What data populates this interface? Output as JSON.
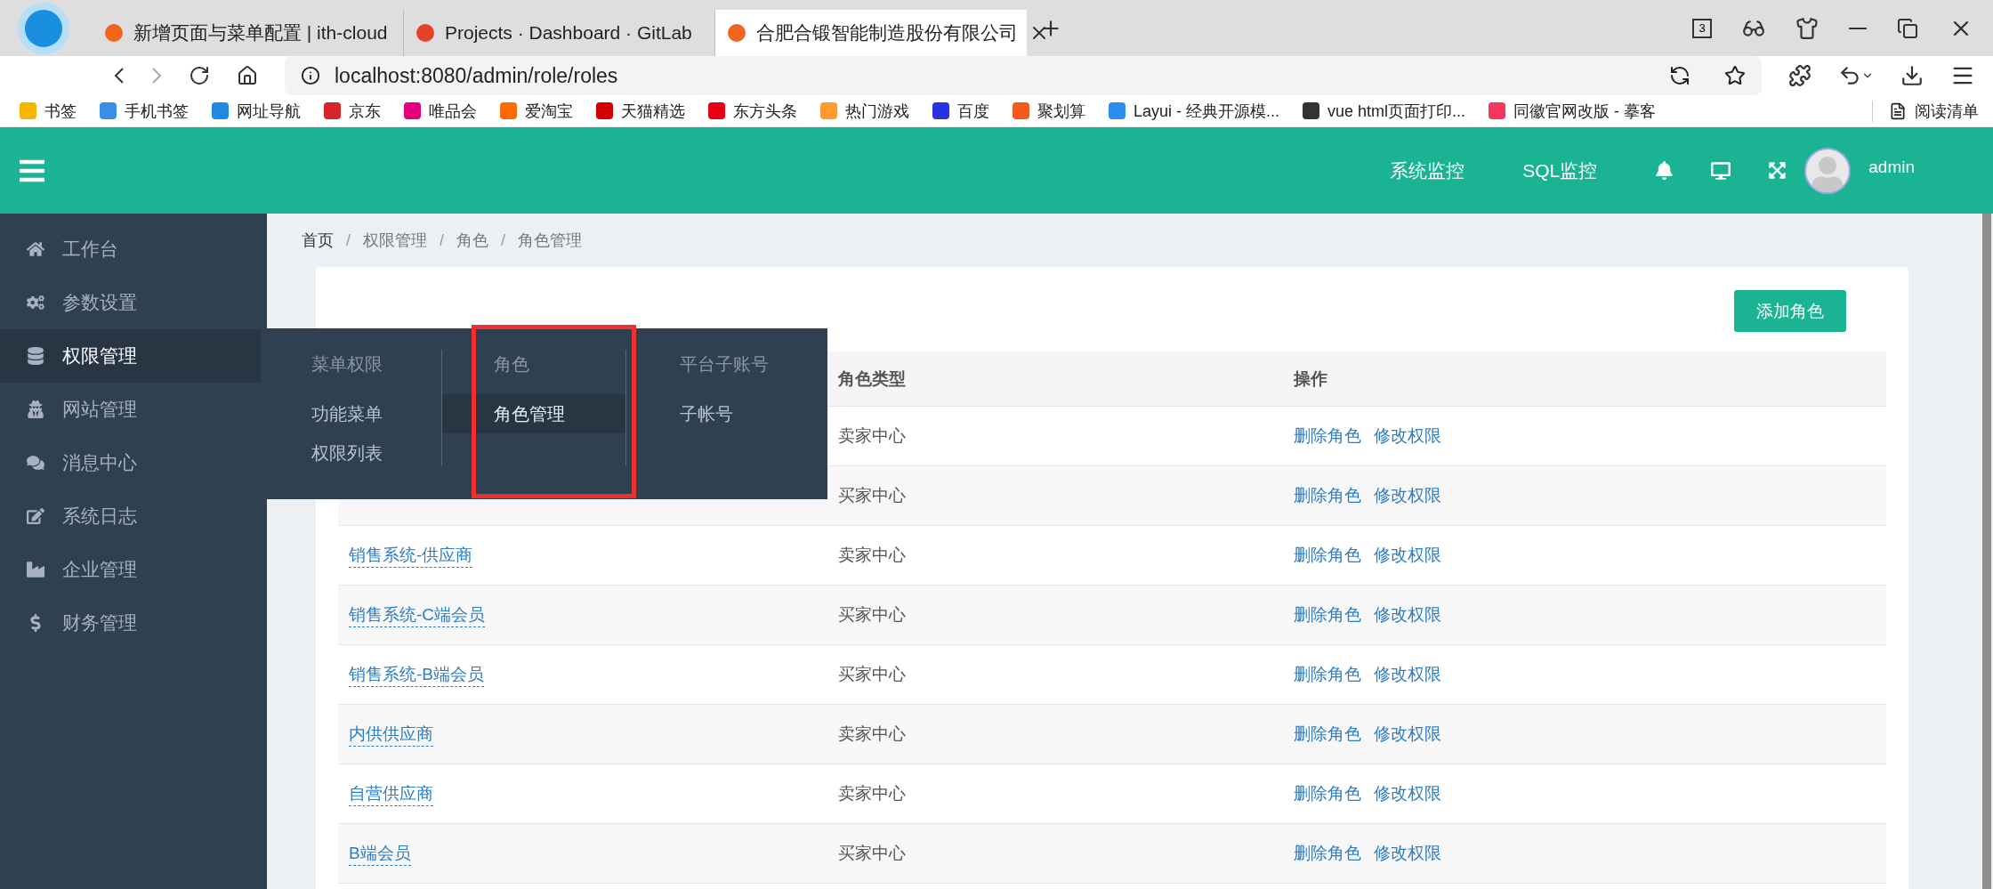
{
  "browser": {
    "tabs": [
      {
        "title": "新增页面与菜单配置 | ith-cloud",
        "selected": false
      },
      {
        "title": "Projects · Dashboard · GitLab",
        "selected": false
      },
      {
        "title": "合肥合锻智能制造股份有限公司",
        "selected": true
      }
    ],
    "tab_count": "3",
    "address": "localhost:8080/admin/role/roles",
    "bookmarks": [
      {
        "label": "书签",
        "color": "#f5b400"
      },
      {
        "label": "手机书签",
        "color": "#3a8ee6"
      },
      {
        "label": "网址导航",
        "color": "#1e88e5"
      },
      {
        "label": "京东",
        "color": "#d8232a"
      },
      {
        "label": "唯品会",
        "color": "#e4007f"
      },
      {
        "label": "爱淘宝",
        "color": "#ff6a00"
      },
      {
        "label": "天猫精选",
        "color": "#d40000"
      },
      {
        "label": "东方头条",
        "color": "#e60012"
      },
      {
        "label": "热门游戏",
        "color": "#ff9a2e"
      },
      {
        "label": "百度",
        "color": "#2932e1"
      },
      {
        "label": "聚划算",
        "color": "#f25a1f"
      },
      {
        "label": "Layui - 经典开源模...",
        "color": "#2d8cf0"
      },
      {
        "label": "vue html页面打印...",
        "color": "#333333"
      },
      {
        "label": "同徽官网改版 - 摹客",
        "color": "#f5365c"
      }
    ],
    "reading_list": "阅读清单"
  },
  "header": {
    "links": [
      "系统监控",
      "SQL监控"
    ],
    "user": "admin"
  },
  "sidebar": {
    "items": [
      {
        "label": "工作台",
        "selected": false
      },
      {
        "label": "参数设置",
        "selected": false
      },
      {
        "label": "权限管理",
        "selected": true
      },
      {
        "label": "网站管理",
        "selected": false
      },
      {
        "label": "消息中心",
        "selected": false
      },
      {
        "label": "系统日志",
        "selected": false
      },
      {
        "label": "企业管理",
        "selected": false
      },
      {
        "label": "财务管理",
        "selected": false
      }
    ]
  },
  "breadcrumb": {
    "items": [
      "首页",
      "权限管理",
      "角色",
      "角色管理"
    ],
    "separators": [
      "/",
      "/",
      "/"
    ]
  },
  "flyout": {
    "columns": [
      {
        "heading": "菜单权限",
        "outlined": false,
        "items": [
          {
            "label": "功能菜单",
            "selected": false
          },
          {
            "label": "权限列表",
            "selected": false
          }
        ]
      },
      {
        "heading": "角色",
        "outlined": true,
        "items": [
          {
            "label": "角色管理",
            "selected": true
          }
        ]
      },
      {
        "heading": "平台子账号",
        "outlined": false,
        "items": [
          {
            "label": "子帐号",
            "selected": false
          }
        ]
      }
    ]
  },
  "add_button": "添加角色",
  "table": {
    "headers": [
      "角色类型",
      "操作"
    ],
    "rows": [
      {
        "type": "卖家中心",
        "actions": [
          "删除角色",
          "修改权限"
        ]
      },
      {
        "type": "买家中心",
        "actions": [
          "删除角色",
          "修改权限"
        ]
      },
      {
        "name": "销售系统-供应商",
        "type": "卖家中心",
        "actions": [
          "删除角色",
          "修改权限"
        ]
      },
      {
        "name": "销售系统-C端会员",
        "type": "买家中心",
        "actions": [
          "删除角色",
          "修改权限"
        ]
      },
      {
        "name": "销售系统-B端会员",
        "type": "买家中心",
        "actions": [
          "删除角色",
          "修改权限"
        ]
      },
      {
        "name": "内供供应商",
        "type": "卖家中心",
        "actions": [
          "删除角色",
          "修改权限"
        ]
      },
      {
        "name": "自营供应商",
        "type": "卖家中心",
        "actions": [
          "删除角色",
          "修改权限"
        ]
      },
      {
        "name": "B端会员",
        "type": "买家中心",
        "actions": [
          "删除角色",
          "修改权限"
        ]
      }
    ]
  }
}
